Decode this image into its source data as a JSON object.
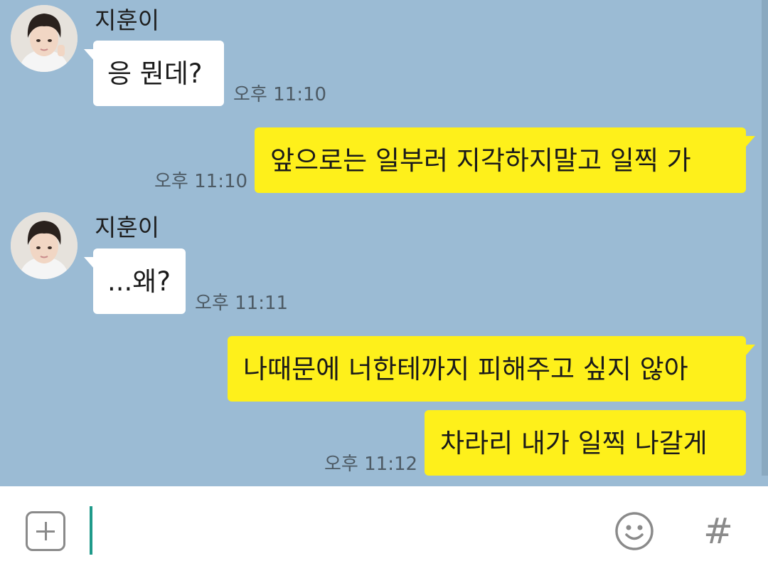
{
  "chat": {
    "sender_name": "지훈이",
    "messages": [
      {
        "side": "in",
        "text": "응 뭔데?",
        "time": "오후 11:10"
      },
      {
        "side": "out",
        "text": "앞으로는 일부러 지각하지말고 일찍 가",
        "time": "오후 11:10"
      },
      {
        "side": "in",
        "text": "...왜?",
        "time": "오후 11:11"
      },
      {
        "side": "out",
        "text": "나때문에 너한테까지 피해주고 싶지 않아",
        "time": ""
      },
      {
        "side": "out",
        "text": "차라리 내가 일찍 나갈게",
        "time": "오후 11:12"
      }
    ]
  },
  "icons": {
    "attach": "plus-box-icon",
    "emoji": "smiley-face-icon",
    "hashtag": "hash-icon"
  },
  "hashtag_glyph": "#",
  "colors": {
    "background": "#9bbbd4",
    "incoming_bubble": "#ffffff",
    "outgoing_bubble": "#fef01b",
    "cursor": "#1f9a8a"
  }
}
